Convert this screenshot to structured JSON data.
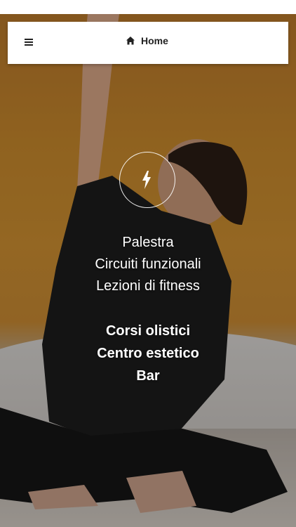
{
  "header": {
    "home_label": "Home"
  },
  "icons": {
    "menu": "hamburger-menu-icon",
    "home": "home-icon",
    "logo": "lightning-bolt-icon"
  },
  "activities_primary": [
    "Palestra",
    "Circuiti funzionali",
    "Lezioni di fitness"
  ],
  "activities_secondary": [
    "Corsi olistici",
    "Centro estetico",
    "Bar"
  ],
  "colors": {
    "text_on_photo": "#ffffff",
    "bar_bg": "#ffffff",
    "bar_text": "#222222"
  }
}
